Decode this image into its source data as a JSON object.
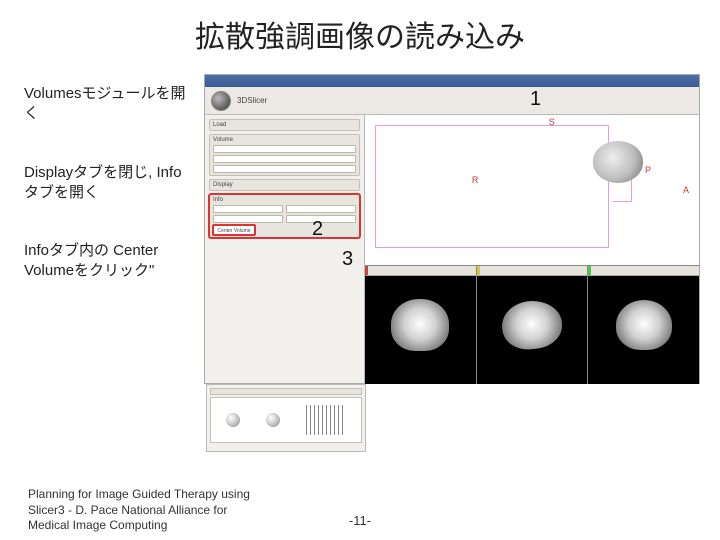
{
  "title": "拡散強調画像の読み込み",
  "instructions": [
    "Volumesモジュールを開く",
    "Displayタブを閉じ, Infoタブを開く",
    "Infoタブ内の Center Volumeをクリック\""
  ],
  "callouts": {
    "c1": "1",
    "c2": "2",
    "c3": "3"
  },
  "screenshot": {
    "app_label": "3DSlicer",
    "orientation": {
      "S": "S",
      "R": "R",
      "P": "P",
      "A": "A"
    },
    "panel": {
      "sections": [
        "Load",
        "Volume",
        "Display",
        "Info"
      ],
      "center_btn": "Center Volume"
    }
  },
  "footer": "Planning for Image Guided Therapy using Slicer3 - D. Pace National Alliance for Medical Image Computing",
  "page_number": "-11-"
}
